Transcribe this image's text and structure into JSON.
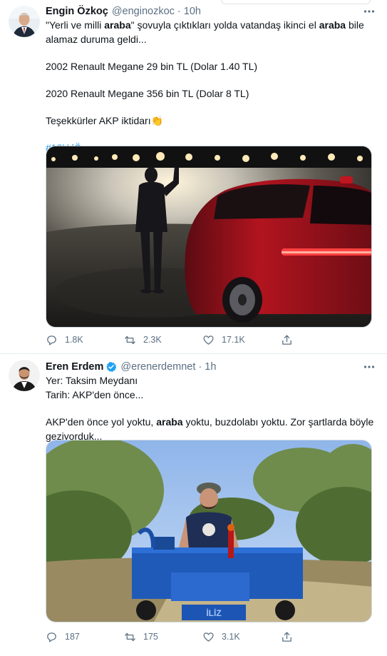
{
  "tweet1": {
    "name": "Engin Özkoç",
    "handle": "@enginozkoc",
    "sep": "·",
    "time": "10h",
    "text": {
      "p1_a": "\"Yerli ve milli ",
      "p1_b": "araba",
      "p1_c": "\" şovuyla çıktıkları yolda vatandaş ikinci el ",
      "p1_d": "araba",
      "p1_e": " bile alamaz duruma geldi...",
      "p2": "2002 Renault Megane 29 bin TL (Dolar 1.40 TL)",
      "p3": "2020 Renault Megane 356 bin TL (Dolar 8 TL)",
      "p4": "Teşekkürler AKP iktidarı",
      "p4_emoji": "👏",
      "hashtag": "#18YılÖnce"
    },
    "stats": {
      "replies": "1.8K",
      "retweets": "2.3K",
      "likes": "17.1K"
    }
  },
  "tweet2": {
    "name": "Eren Erdem",
    "handle": "@erenerdemnet",
    "sep": "·",
    "time": "1h",
    "text": {
      "l1": "Yer: Taksim Meydanı",
      "l2": "Tarih: AKP'den önce...",
      "p2_a": "AKP'den önce yol yoktu, ",
      "p2_b": "araba",
      "p2_c": " yoktu, buzdolabı yoktu. Zor şartlarda böyle geziyorduk..."
    },
    "stats": {
      "replies": "187",
      "retweets": "175",
      "likes": "3.1K"
    },
    "tractor_plate": "İLİZ"
  },
  "icons": {
    "reply": "reply-icon",
    "retweet": "retweet-icon",
    "like": "heart-icon",
    "share": "share-icon",
    "more": "more-icon",
    "verified": "verified-badge-icon"
  },
  "colors": {
    "secondary": "#5b7083",
    "link": "#1b95e0",
    "verified": "#1da1f2",
    "border": "#e6ecf0"
  }
}
